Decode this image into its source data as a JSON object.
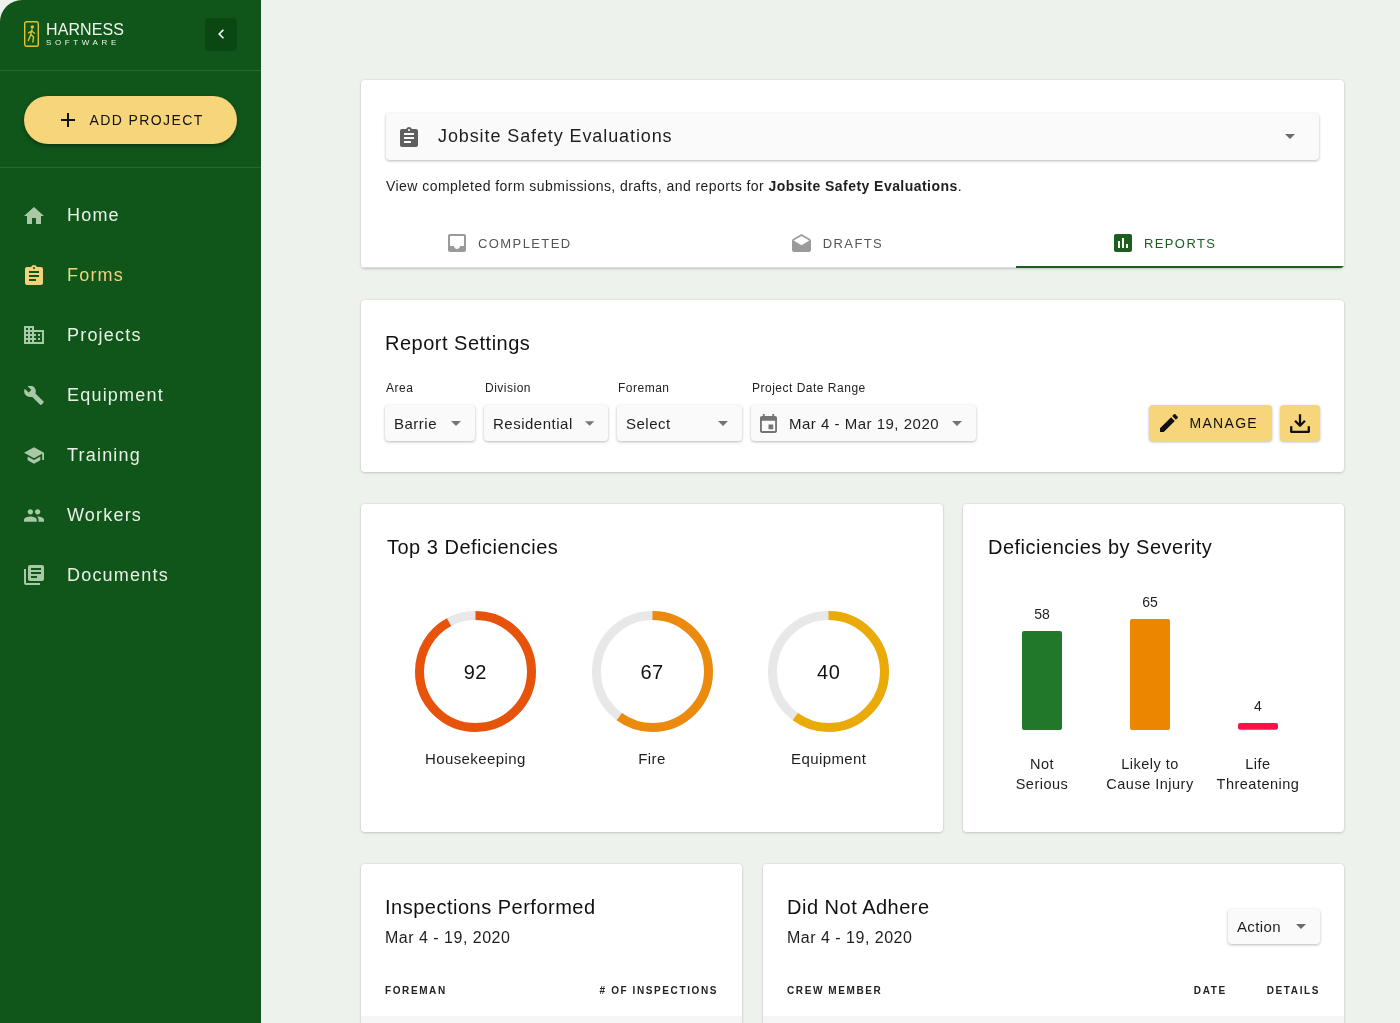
{
  "sidebar": {
    "logo": {
      "name": "HARNESS",
      "tagline": "SOFTWARE"
    },
    "add_button": {
      "label": "ADD PROJECT"
    },
    "items": [
      {
        "label": "Home",
        "selected": false
      },
      {
        "label": "Forms",
        "selected": true
      },
      {
        "label": "Projects",
        "selected": false
      },
      {
        "label": "Equipment",
        "selected": false
      },
      {
        "label": "Training",
        "selected": false
      },
      {
        "label": "Workers",
        "selected": false
      },
      {
        "label": "Documents",
        "selected": false
      }
    ]
  },
  "form_picker": {
    "value": "Jobsite Safety Evaluations"
  },
  "description": "View completed form submissions, drafts, and reports for **Jobsite Safety Evaluations**.",
  "tabs": [
    {
      "label": "COMPLETED",
      "selected": false
    },
    {
      "label": "DRAFTS",
      "selected": false
    },
    {
      "label": "REPORTS",
      "selected": true
    }
  ],
  "report_settings": {
    "title": "Report Settings",
    "filters": [
      {
        "kind": "select",
        "label": "Area",
        "value": "Barrie"
      },
      {
        "kind": "select",
        "label": "Division",
        "value": "Residential"
      },
      {
        "kind": "select",
        "label": "Foreman",
        "value": "Select"
      },
      {
        "kind": "date",
        "label": "Project Date Range",
        "value": "Mar 4 - Mar 19, 2020"
      }
    ],
    "manage_button": {
      "label": "MANAGE"
    }
  },
  "top_deficiencies": {
    "title": "Top 3 Deficiencies",
    "items": [
      {
        "value": "92",
        "label": "Housekeeping",
        "level": 0.92,
        "color": "#e8530c"
      },
      {
        "value": "67",
        "label": "Fire",
        "level": 0.6,
        "color": "#eb8a0c"
      },
      {
        "value": "40",
        "label": "Equipment",
        "level": 0.6,
        "color": "#eaaa08"
      }
    ]
  },
  "severity": {
    "title": "Deficiencies by Severity",
    "chart_data": {
      "type": "bar",
      "categories": [
        "Not\nSerious",
        "Likely to\nCause Injury",
        "Life\nThreatening"
      ],
      "series": [
        {
          "values": [
            58,
            65,
            4
          ]
        }
      ],
      "colors": [
        "#22782a",
        "#ec8600",
        "#ff1147"
      ],
      "data_labels": true
    }
  },
  "inspections": {
    "title": "Inspections Performed",
    "date_range": "Mar 4 - 19, 2020",
    "columns": [
      "FOREMAN",
      "# OF INSPECTIONS"
    ]
  },
  "did_not_adhere": {
    "title": "Did Not Adhere",
    "date_range": "Mar 4 - 19, 2020",
    "action_button": {
      "label": "Action"
    },
    "columns": [
      "CREW MEMBER",
      "DATE",
      "DETAILS"
    ]
  }
}
